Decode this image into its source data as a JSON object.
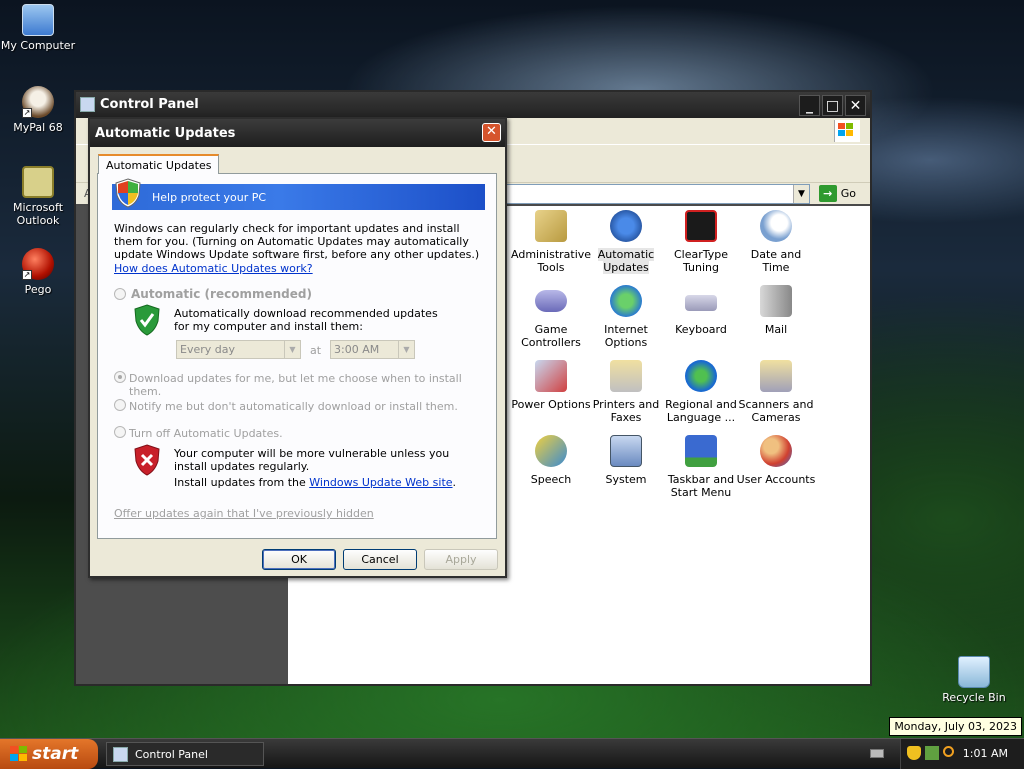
{
  "desktop": {
    "icons": [
      {
        "label": "My Computer",
        "icon": "my-computer-icon"
      },
      {
        "label": "MyPal 68",
        "icon": "mypal-icon"
      },
      {
        "label": "Microsoft Outlook",
        "icon": "outlook-icon"
      },
      {
        "label": "Pego",
        "icon": "pego-icon"
      },
      {
        "label": "Recycle Bin",
        "icon": "recycle-bin-icon"
      }
    ]
  },
  "control_panel": {
    "title": "Control Panel",
    "address_prefix": "A",
    "go_label": "Go",
    "items": [
      {
        "label": "Administrative Tools",
        "icon": "admin-tools-icon"
      },
      {
        "label": "Automatic Updates",
        "icon": "automatic-updates-icon"
      },
      {
        "label": "ClearType Tuning",
        "icon": "cleartype-icon"
      },
      {
        "label": "Date and Time",
        "icon": "date-time-icon"
      },
      {
        "label": "Game Controllers",
        "icon": "game-controller-icon"
      },
      {
        "label": "Internet Options",
        "icon": "internet-options-icon"
      },
      {
        "label": "Keyboard",
        "icon": "keyboard-icon"
      },
      {
        "label": "Mail",
        "icon": "mail-icon"
      },
      {
        "label": "Power Options",
        "icon": "power-options-icon"
      },
      {
        "label": "Printers and Faxes",
        "icon": "printer-icon"
      },
      {
        "label": "Regional and Language ...",
        "icon": "globe-icon"
      },
      {
        "label": "Scanners and Cameras",
        "icon": "scanner-icon"
      },
      {
        "label": "Speech",
        "icon": "speech-icon"
      },
      {
        "label": "System",
        "icon": "system-icon"
      },
      {
        "label": "Taskbar and Start Menu",
        "icon": "taskbar-icon"
      },
      {
        "label": "User Accounts",
        "icon": "user-accounts-icon"
      }
    ]
  },
  "dialog": {
    "title": "Automatic Updates",
    "tab_label": "Automatic Updates",
    "banner": "Help protect your PC",
    "intro": "Windows can regularly check for important updates and install them for you. (Turning on Automatic Updates may automatically update Windows Update software first, before any other updates.)",
    "how_link": "How does Automatic Updates work?",
    "option_automatic": "Automatic (recommended)",
    "automatic_desc": "Automatically download recommended updates for my computer and install them:",
    "day_select": "Every day",
    "at_label": "at",
    "time_select": "3:00 AM",
    "option_download": "Download updates for me, but let me choose when to install them.",
    "option_notify": "Notify me but don't automatically download or install them.",
    "option_off": "Turn off Automatic Updates.",
    "off_warning": "Your computer will be more vulnerable unless you install updates regularly.",
    "install_from_prefix": "Install updates from the ",
    "install_from_link": "Windows Update Web site",
    "install_from_suffix": ".",
    "offer_again": "Offer updates again that I've previously hidden",
    "ok": "OK",
    "cancel": "Cancel",
    "apply": "Apply"
  },
  "taskbar": {
    "start": "start",
    "task_label": "Control Panel",
    "clock": "1:01 AM",
    "date_tooltip": "Monday, July 03, 2023"
  }
}
